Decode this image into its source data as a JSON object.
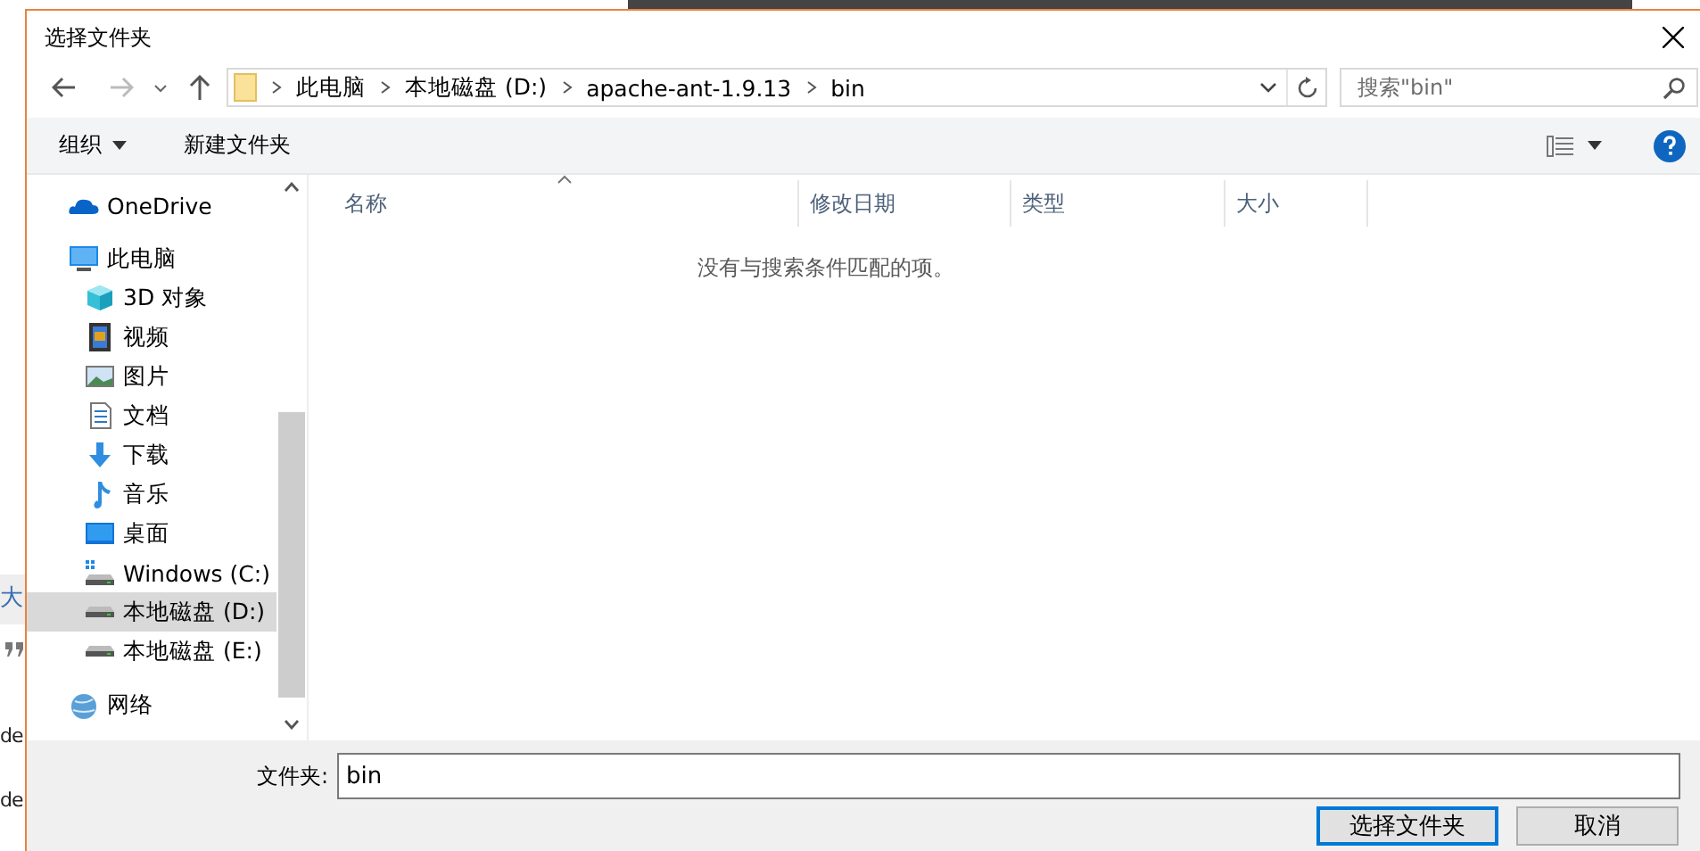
{
  "background_page": {
    "side_texts": [
      "大",
      "de",
      "de"
    ]
  },
  "window": {
    "title": "选择文件夹"
  },
  "address_bar": {
    "crumbs": [
      "此电脑",
      "本地磁盘 (D:)",
      "apache-ant-1.9.13",
      "bin"
    ]
  },
  "search": {
    "placeholder": "搜索\"bin\""
  },
  "toolbar": {
    "organize": "组织",
    "new_folder": "新建文件夹"
  },
  "sidebar": {
    "items": [
      {
        "label": "OneDrive",
        "kind": "cloud",
        "selected": false
      },
      {
        "label": "此电脑",
        "kind": "computer",
        "selected": false,
        "children": [
          {
            "label": "3D 对象",
            "kind": "cube",
            "selected": false
          },
          {
            "label": "视频",
            "kind": "film",
            "selected": false
          },
          {
            "label": "图片",
            "kind": "picture",
            "selected": false
          },
          {
            "label": "文档",
            "kind": "document",
            "selected": false
          },
          {
            "label": "下载",
            "kind": "download",
            "selected": false
          },
          {
            "label": "音乐",
            "kind": "music",
            "selected": false
          },
          {
            "label": "桌面",
            "kind": "desktop",
            "selected": false
          },
          {
            "label": "Windows (C:)",
            "kind": "windrive",
            "selected": false
          },
          {
            "label": "本地磁盘 (D:)",
            "kind": "drive",
            "selected": true
          },
          {
            "label": "本地磁盘 (E:)",
            "kind": "drive",
            "selected": false
          }
        ]
      },
      {
        "label": "网络",
        "kind": "network",
        "selected": false
      }
    ]
  },
  "table": {
    "columns": [
      "名称",
      "修改日期",
      "类型",
      "大小"
    ],
    "empty_message": "没有与搜索条件匹配的项。"
  },
  "footer": {
    "folder_label": "文件夹:",
    "folder_value": "bin",
    "buttons": [
      "选择文件夹",
      "取消"
    ]
  }
}
